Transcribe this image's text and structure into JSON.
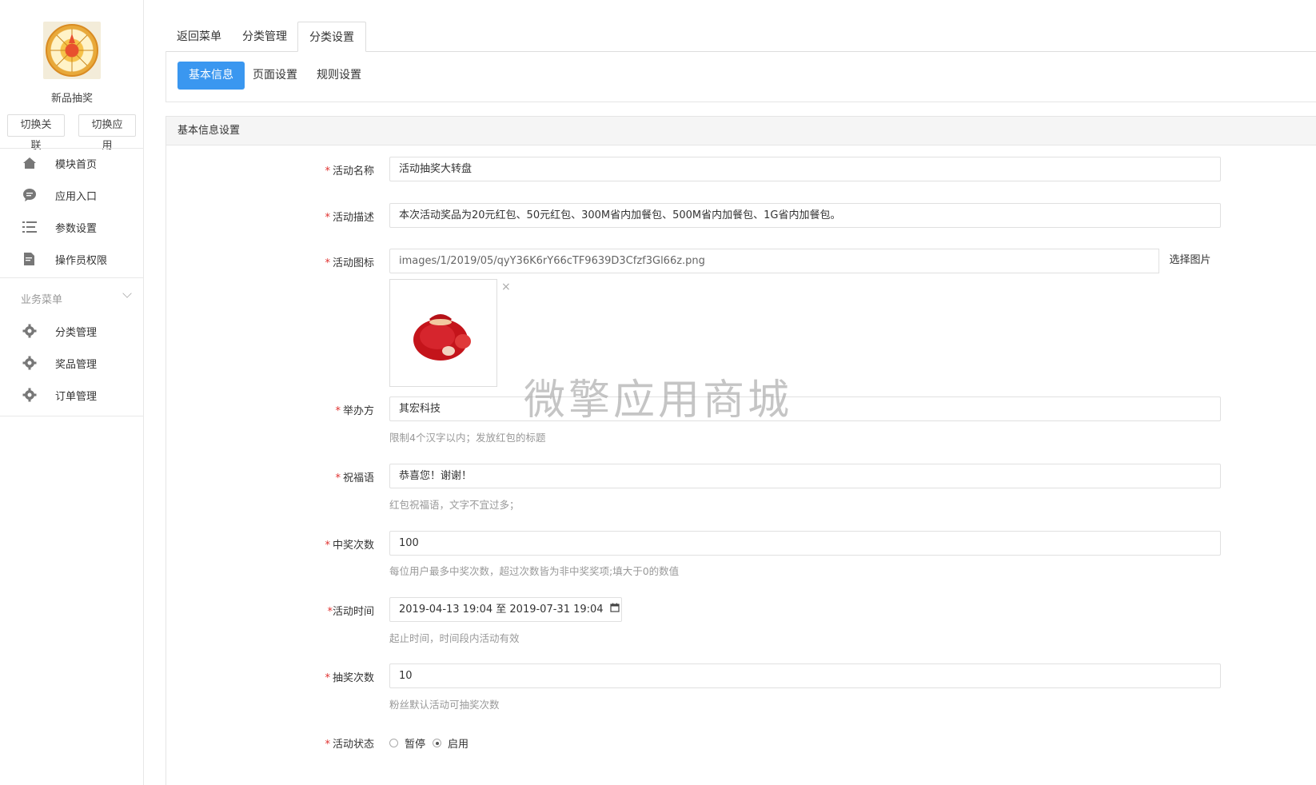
{
  "sidebar": {
    "app_name": "新品抽奖",
    "switch_link_label": "切换关联",
    "switch_app_label": "切换应用",
    "nav": [
      {
        "label": "模块首页",
        "icon": "home-icon"
      },
      {
        "label": "应用入口",
        "icon": "chat-icon"
      },
      {
        "label": "参数设置",
        "icon": "list-icon"
      },
      {
        "label": "操作员权限",
        "icon": "document-edit-icon"
      }
    ],
    "section_title": "业务菜单",
    "business_nav": [
      {
        "label": "分类管理",
        "icon": "gear-icon"
      },
      {
        "label": "奖品管理",
        "icon": "gear-icon"
      },
      {
        "label": "订单管理",
        "icon": "gear-icon"
      }
    ]
  },
  "tabs": [
    "返回菜单",
    "分类管理",
    "分类设置"
  ],
  "active_tab": "分类设置",
  "subtabs": [
    "基本信息",
    "页面设置",
    "规则设置"
  ],
  "active_subtab": "基本信息",
  "panel_title": "基本信息设置",
  "form": {
    "name": {
      "label": "活动名称",
      "value": "活动抽奖大转盘"
    },
    "desc": {
      "label": "活动描述",
      "value": "本次活动奖品为20元红包、50元红包、300M省内加餐包、500M省内加餐包、1G省内加餐包。"
    },
    "icon": {
      "label": "活动图标",
      "value": "images/1/2019/05/qyY36K6rY66cTF9639D3Cfzf3Gl66z.png",
      "button": "选择图片",
      "remove": "×"
    },
    "organizer": {
      "label": "举办方",
      "value": "其宏科技",
      "help": "限制4个汉字以内；发放红包的标题"
    },
    "blessing": {
      "label": "祝福语",
      "value": "恭喜您！谢谢！",
      "help": "红包祝福语，文字不宜过多；"
    },
    "win_times": {
      "label": "中奖次数",
      "value": "100",
      "help": "每位用户最多中奖次数，超过次数皆为非中奖奖项;填大于0的数值"
    },
    "time": {
      "label": "活动时间",
      "value": "2019-04-13 19:04 至 2019-07-31 19:04",
      "help": "起止时间，时间段内活动有效"
    },
    "draw_times": {
      "label": "抽奖次数",
      "value": "10",
      "help": "粉丝默认活动可抽奖次数"
    },
    "status": {
      "label": "活动状态",
      "options": [
        "暂停",
        "启用"
      ],
      "selected": "启用"
    }
  },
  "watermark": "微擎应用商城",
  "colors": {
    "primary": "#3a97f0",
    "required": "#e0312f"
  }
}
